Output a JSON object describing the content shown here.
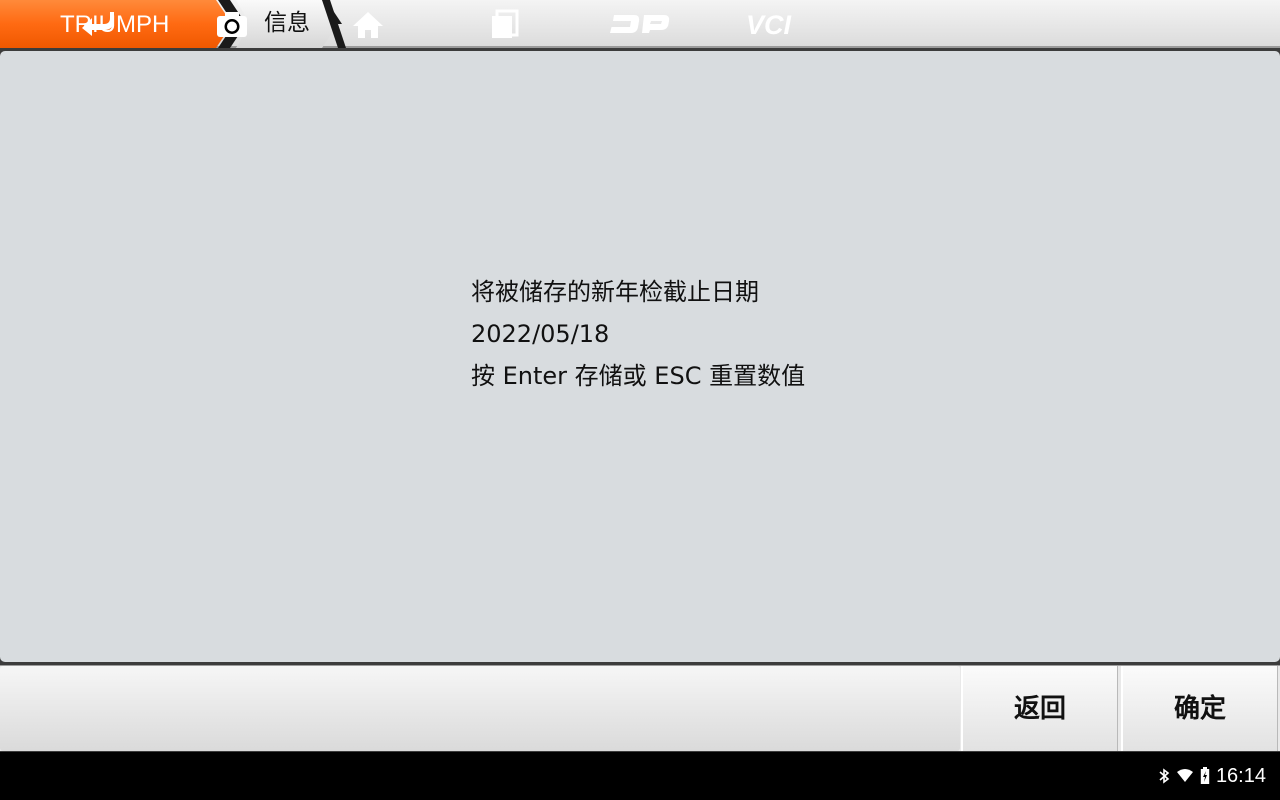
{
  "breadcrumb": {
    "brand": "TRIUMPH",
    "current": "信息"
  },
  "message": {
    "lines": [
      "将被储存的新年检截止日期",
      "2022/05/18",
      "按 Enter 存储或 ESC 重置数值"
    ]
  },
  "buttons": {
    "back_label": "返回",
    "confirm_label": "确定"
  },
  "navbar": {
    "icons": [
      "back-icon",
      "camera-icon",
      "home-icon",
      "recent-apps-icon",
      "dp-logo-icon",
      "vci-icon"
    ],
    "vci_label": "VCI",
    "dp_label": "DP"
  },
  "status": {
    "time": "16:14",
    "icons": [
      "bluetooth-icon",
      "wifi-icon",
      "battery-icon"
    ]
  },
  "colors": {
    "brand_orange": "#ff6a12",
    "panel_bg": "#d8dcdf",
    "navbar_bg": "#000000"
  }
}
